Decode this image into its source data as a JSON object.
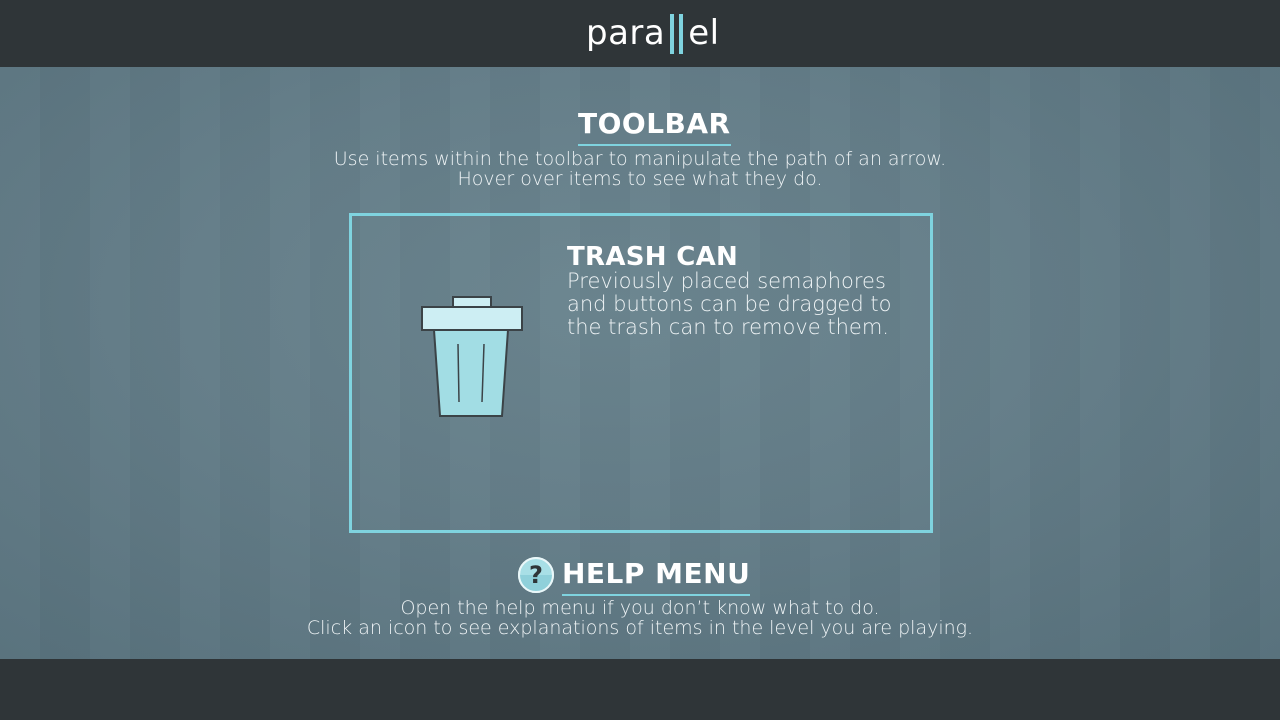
{
  "header": {
    "logo_left": "para",
    "logo_right": "el"
  },
  "toolbar_section": {
    "title": "TOOLBAR",
    "lines": [
      "Use items within the toolbar to manipulate the path of an arrow.",
      "Hover over items to see what they do."
    ]
  },
  "item_panel": {
    "title": "TRASH CAN",
    "lines": [
      "Previously placed semaphores",
      "and buttons can be dragged to",
      "the trash can to remove them."
    ],
    "icon": "trash-can-icon"
  },
  "help_section": {
    "title": "HELP MENU",
    "icon_glyph": "?",
    "icon": "help-question-icon",
    "lines": [
      "Open the help menu if you don’t know what to do.",
      "Click an icon to see explanations of items in the level you are playing."
    ]
  },
  "colors": {
    "accent": "#7fd3df",
    "bar_background": "#2f3538",
    "main_background": "#647d88"
  }
}
